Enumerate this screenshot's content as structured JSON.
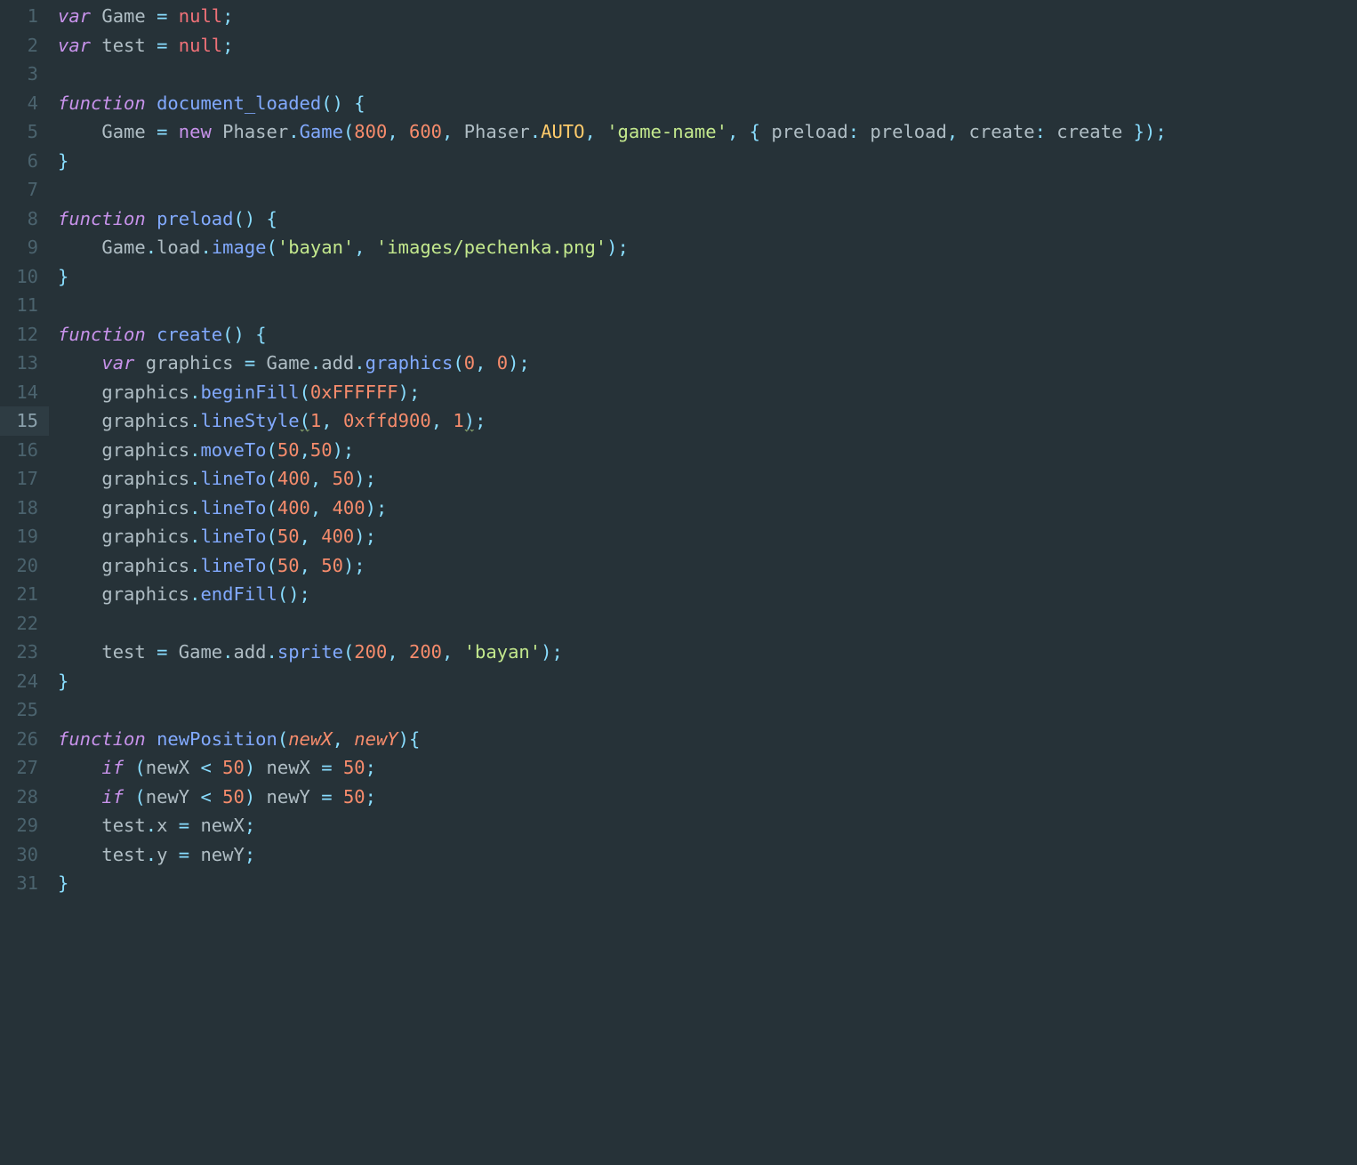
{
  "editor": {
    "activeLine": 15,
    "lineCount": 31,
    "lines": {
      "1": [
        {
          "t": "kw",
          "v": "var"
        },
        {
          "t": "sp",
          "v": " "
        },
        {
          "t": "ident",
          "v": "Game"
        },
        {
          "t": "sp",
          "v": " "
        },
        {
          "t": "op",
          "v": "="
        },
        {
          "t": "sp",
          "v": " "
        },
        {
          "t": "null",
          "v": "null"
        },
        {
          "t": "op",
          "v": ";"
        }
      ],
      "2": [
        {
          "t": "kw",
          "v": "var"
        },
        {
          "t": "sp",
          "v": " "
        },
        {
          "t": "ident",
          "v": "test"
        },
        {
          "t": "sp",
          "v": " "
        },
        {
          "t": "op",
          "v": "="
        },
        {
          "t": "sp",
          "v": " "
        },
        {
          "t": "null",
          "v": "null"
        },
        {
          "t": "op",
          "v": ";"
        }
      ],
      "3": [],
      "4": [
        {
          "t": "kw",
          "v": "function"
        },
        {
          "t": "sp",
          "v": " "
        },
        {
          "t": "funcdef",
          "v": "document_loaded"
        },
        {
          "t": "op",
          "v": "()"
        },
        {
          "t": "sp",
          "v": " "
        },
        {
          "t": "op",
          "v": "{"
        }
      ],
      "5": [
        {
          "t": "sp",
          "v": "    "
        },
        {
          "t": "ident",
          "v": "Game"
        },
        {
          "t": "sp",
          "v": " "
        },
        {
          "t": "op",
          "v": "="
        },
        {
          "t": "sp",
          "v": " "
        },
        {
          "t": "kw2",
          "v": "new"
        },
        {
          "t": "sp",
          "v": " "
        },
        {
          "t": "ident",
          "v": "Phaser"
        },
        {
          "t": "op",
          "v": "."
        },
        {
          "t": "func",
          "v": "Game"
        },
        {
          "t": "op",
          "v": "("
        },
        {
          "t": "num",
          "v": "800"
        },
        {
          "t": "op",
          "v": ","
        },
        {
          "t": "sp",
          "v": " "
        },
        {
          "t": "num",
          "v": "600"
        },
        {
          "t": "op",
          "v": ","
        },
        {
          "t": "sp",
          "v": " "
        },
        {
          "t": "ident",
          "v": "Phaser"
        },
        {
          "t": "op",
          "v": "."
        },
        {
          "t": "class",
          "v": "AUTO"
        },
        {
          "t": "op",
          "v": ","
        },
        {
          "t": "sp",
          "v": " "
        },
        {
          "t": "str",
          "v": "'game-name'"
        },
        {
          "t": "op",
          "v": ","
        },
        {
          "t": "sp",
          "v": " "
        },
        {
          "t": "op",
          "v": "{"
        },
        {
          "t": "sp",
          "v": " "
        },
        {
          "t": "objkey",
          "v": "preload"
        },
        {
          "t": "op",
          "v": ":"
        },
        {
          "t": "sp",
          "v": " "
        },
        {
          "t": "ident",
          "v": "preload"
        },
        {
          "t": "op",
          "v": ","
        },
        {
          "t": "sp",
          "v": " "
        },
        {
          "t": "objkey",
          "v": "create"
        },
        {
          "t": "op",
          "v": ":"
        },
        {
          "t": "sp",
          "v": " "
        },
        {
          "t": "ident",
          "v": "create"
        },
        {
          "t": "sp",
          "v": " "
        },
        {
          "t": "op",
          "v": "});"
        }
      ],
      "6": [
        {
          "t": "op",
          "v": "}"
        }
      ],
      "7": [],
      "8": [
        {
          "t": "kw",
          "v": "function"
        },
        {
          "t": "sp",
          "v": " "
        },
        {
          "t": "funcdef",
          "v": "preload"
        },
        {
          "t": "op",
          "v": "()"
        },
        {
          "t": "sp",
          "v": " "
        },
        {
          "t": "op",
          "v": "{"
        }
      ],
      "9": [
        {
          "t": "sp",
          "v": "    "
        },
        {
          "t": "ident",
          "v": "Game"
        },
        {
          "t": "op",
          "v": "."
        },
        {
          "t": "prop",
          "v": "load"
        },
        {
          "t": "op",
          "v": "."
        },
        {
          "t": "func",
          "v": "image"
        },
        {
          "t": "op",
          "v": "("
        },
        {
          "t": "str",
          "v": "'bayan'"
        },
        {
          "t": "op",
          "v": ","
        },
        {
          "t": "sp",
          "v": " "
        },
        {
          "t": "str",
          "v": "'images/pechenka.png'"
        },
        {
          "t": "op",
          "v": ");"
        }
      ],
      "10": [
        {
          "t": "op",
          "v": "}"
        }
      ],
      "11": [],
      "12": [
        {
          "t": "kw",
          "v": "function"
        },
        {
          "t": "sp",
          "v": " "
        },
        {
          "t": "funcdef",
          "v": "create"
        },
        {
          "t": "op",
          "v": "()"
        },
        {
          "t": "sp",
          "v": " "
        },
        {
          "t": "op",
          "v": "{"
        }
      ],
      "13": [
        {
          "t": "sp",
          "v": "    "
        },
        {
          "t": "kw",
          "v": "var"
        },
        {
          "t": "sp",
          "v": " "
        },
        {
          "t": "ident",
          "v": "graphics"
        },
        {
          "t": "sp",
          "v": " "
        },
        {
          "t": "op",
          "v": "="
        },
        {
          "t": "sp",
          "v": " "
        },
        {
          "t": "ident",
          "v": "Game"
        },
        {
          "t": "op",
          "v": "."
        },
        {
          "t": "prop",
          "v": "add"
        },
        {
          "t": "op",
          "v": "."
        },
        {
          "t": "func",
          "v": "graphics"
        },
        {
          "t": "op",
          "v": "("
        },
        {
          "t": "num",
          "v": "0"
        },
        {
          "t": "op",
          "v": ","
        },
        {
          "t": "sp",
          "v": " "
        },
        {
          "t": "num",
          "v": "0"
        },
        {
          "t": "op",
          "v": ");"
        }
      ],
      "14": [
        {
          "t": "sp",
          "v": "    "
        },
        {
          "t": "ident",
          "v": "graphics"
        },
        {
          "t": "op",
          "v": "."
        },
        {
          "t": "func",
          "v": "beginFill"
        },
        {
          "t": "op",
          "v": "("
        },
        {
          "t": "num",
          "v": "0xFFFFFF"
        },
        {
          "t": "op",
          "v": ");"
        }
      ],
      "15": [
        {
          "t": "sp",
          "v": "    "
        },
        {
          "t": "ident",
          "v": "graphics"
        },
        {
          "t": "op",
          "v": "."
        },
        {
          "t": "func",
          "v": "lineStyle"
        },
        {
          "t": "op-sq",
          "v": "("
        },
        {
          "t": "num",
          "v": "1"
        },
        {
          "t": "op",
          "v": ","
        },
        {
          "t": "sp",
          "v": " "
        },
        {
          "t": "num",
          "v": "0xffd900"
        },
        {
          "t": "op",
          "v": ","
        },
        {
          "t": "sp",
          "v": " "
        },
        {
          "t": "num",
          "v": "1"
        },
        {
          "t": "op-sq",
          "v": ")"
        },
        {
          "t": "op",
          "v": ";"
        }
      ],
      "16": [
        {
          "t": "sp",
          "v": "    "
        },
        {
          "t": "ident",
          "v": "graphics"
        },
        {
          "t": "op",
          "v": "."
        },
        {
          "t": "func",
          "v": "moveTo"
        },
        {
          "t": "op",
          "v": "("
        },
        {
          "t": "num",
          "v": "50"
        },
        {
          "t": "op",
          "v": ","
        },
        {
          "t": "num",
          "v": "50"
        },
        {
          "t": "op",
          "v": ");"
        }
      ],
      "17": [
        {
          "t": "sp",
          "v": "    "
        },
        {
          "t": "ident",
          "v": "graphics"
        },
        {
          "t": "op",
          "v": "."
        },
        {
          "t": "func",
          "v": "lineTo"
        },
        {
          "t": "op",
          "v": "("
        },
        {
          "t": "num",
          "v": "400"
        },
        {
          "t": "op",
          "v": ","
        },
        {
          "t": "sp",
          "v": " "
        },
        {
          "t": "num",
          "v": "50"
        },
        {
          "t": "op",
          "v": ");"
        }
      ],
      "18": [
        {
          "t": "sp",
          "v": "    "
        },
        {
          "t": "ident",
          "v": "graphics"
        },
        {
          "t": "op",
          "v": "."
        },
        {
          "t": "func",
          "v": "lineTo"
        },
        {
          "t": "op",
          "v": "("
        },
        {
          "t": "num",
          "v": "400"
        },
        {
          "t": "op",
          "v": ","
        },
        {
          "t": "sp",
          "v": " "
        },
        {
          "t": "num",
          "v": "400"
        },
        {
          "t": "op",
          "v": ");"
        }
      ],
      "19": [
        {
          "t": "sp",
          "v": "    "
        },
        {
          "t": "ident",
          "v": "graphics"
        },
        {
          "t": "op",
          "v": "."
        },
        {
          "t": "func",
          "v": "lineTo"
        },
        {
          "t": "op",
          "v": "("
        },
        {
          "t": "num",
          "v": "50"
        },
        {
          "t": "op",
          "v": ","
        },
        {
          "t": "sp",
          "v": " "
        },
        {
          "t": "num",
          "v": "400"
        },
        {
          "t": "op",
          "v": ");"
        }
      ],
      "20": [
        {
          "t": "sp",
          "v": "    "
        },
        {
          "t": "ident",
          "v": "graphics"
        },
        {
          "t": "op",
          "v": "."
        },
        {
          "t": "func",
          "v": "lineTo"
        },
        {
          "t": "op",
          "v": "("
        },
        {
          "t": "num",
          "v": "50"
        },
        {
          "t": "op",
          "v": ","
        },
        {
          "t": "sp",
          "v": " "
        },
        {
          "t": "num",
          "v": "50"
        },
        {
          "t": "op",
          "v": ");"
        }
      ],
      "21": [
        {
          "t": "sp",
          "v": "    "
        },
        {
          "t": "ident",
          "v": "graphics"
        },
        {
          "t": "op",
          "v": "."
        },
        {
          "t": "func",
          "v": "endFill"
        },
        {
          "t": "op",
          "v": "();"
        }
      ],
      "22": [],
      "23": [
        {
          "t": "sp",
          "v": "    "
        },
        {
          "t": "ident",
          "v": "test"
        },
        {
          "t": "sp",
          "v": " "
        },
        {
          "t": "op",
          "v": "="
        },
        {
          "t": "sp",
          "v": " "
        },
        {
          "t": "ident",
          "v": "Game"
        },
        {
          "t": "op",
          "v": "."
        },
        {
          "t": "prop",
          "v": "add"
        },
        {
          "t": "op",
          "v": "."
        },
        {
          "t": "func",
          "v": "sprite"
        },
        {
          "t": "op",
          "v": "("
        },
        {
          "t": "num",
          "v": "200"
        },
        {
          "t": "op",
          "v": ","
        },
        {
          "t": "sp",
          "v": " "
        },
        {
          "t": "num",
          "v": "200"
        },
        {
          "t": "op",
          "v": ","
        },
        {
          "t": "sp",
          "v": " "
        },
        {
          "t": "str",
          "v": "'bayan'"
        },
        {
          "t": "op",
          "v": ");"
        }
      ],
      "24": [
        {
          "t": "op",
          "v": "}"
        }
      ],
      "25": [],
      "26": [
        {
          "t": "kw",
          "v": "function"
        },
        {
          "t": "sp",
          "v": " "
        },
        {
          "t": "funcdef",
          "v": "newPosition"
        },
        {
          "t": "op",
          "v": "("
        },
        {
          "t": "param",
          "v": "newX"
        },
        {
          "t": "op",
          "v": ","
        },
        {
          "t": "sp",
          "v": " "
        },
        {
          "t": "param",
          "v": "newY"
        },
        {
          "t": "op",
          "v": "){"
        }
      ],
      "27": [
        {
          "t": "sp",
          "v": "    "
        },
        {
          "t": "kw",
          "v": "if"
        },
        {
          "t": "sp",
          "v": " "
        },
        {
          "t": "op",
          "v": "("
        },
        {
          "t": "ident",
          "v": "newX"
        },
        {
          "t": "sp",
          "v": " "
        },
        {
          "t": "op",
          "v": "<"
        },
        {
          "t": "sp",
          "v": " "
        },
        {
          "t": "num",
          "v": "50"
        },
        {
          "t": "op",
          "v": ")"
        },
        {
          "t": "sp",
          "v": " "
        },
        {
          "t": "ident",
          "v": "newX"
        },
        {
          "t": "sp",
          "v": " "
        },
        {
          "t": "op",
          "v": "="
        },
        {
          "t": "sp",
          "v": " "
        },
        {
          "t": "num",
          "v": "50"
        },
        {
          "t": "op",
          "v": ";"
        }
      ],
      "28": [
        {
          "t": "sp",
          "v": "    "
        },
        {
          "t": "kw",
          "v": "if"
        },
        {
          "t": "sp",
          "v": " "
        },
        {
          "t": "op",
          "v": "("
        },
        {
          "t": "ident",
          "v": "newY"
        },
        {
          "t": "sp",
          "v": " "
        },
        {
          "t": "op",
          "v": "<"
        },
        {
          "t": "sp",
          "v": " "
        },
        {
          "t": "num",
          "v": "50"
        },
        {
          "t": "op",
          "v": ")"
        },
        {
          "t": "sp",
          "v": " "
        },
        {
          "t": "ident",
          "v": "newY"
        },
        {
          "t": "sp",
          "v": " "
        },
        {
          "t": "op",
          "v": "="
        },
        {
          "t": "sp",
          "v": " "
        },
        {
          "t": "num",
          "v": "50"
        },
        {
          "t": "op",
          "v": ";"
        }
      ],
      "29": [
        {
          "t": "sp",
          "v": "    "
        },
        {
          "t": "ident",
          "v": "test"
        },
        {
          "t": "op",
          "v": "."
        },
        {
          "t": "prop",
          "v": "x"
        },
        {
          "t": "sp",
          "v": " "
        },
        {
          "t": "op",
          "v": "="
        },
        {
          "t": "sp",
          "v": " "
        },
        {
          "t": "ident",
          "v": "newX"
        },
        {
          "t": "op",
          "v": ";"
        }
      ],
      "30": [
        {
          "t": "sp",
          "v": "    "
        },
        {
          "t": "ident",
          "v": "test"
        },
        {
          "t": "op",
          "v": "."
        },
        {
          "t": "prop",
          "v": "y"
        },
        {
          "t": "sp",
          "v": " "
        },
        {
          "t": "op",
          "v": "="
        },
        {
          "t": "sp",
          "v": " "
        },
        {
          "t": "ident",
          "v": "newY"
        },
        {
          "t": "op",
          "v": ";"
        }
      ],
      "31": [
        {
          "t": "op",
          "v": "}"
        }
      ]
    }
  }
}
